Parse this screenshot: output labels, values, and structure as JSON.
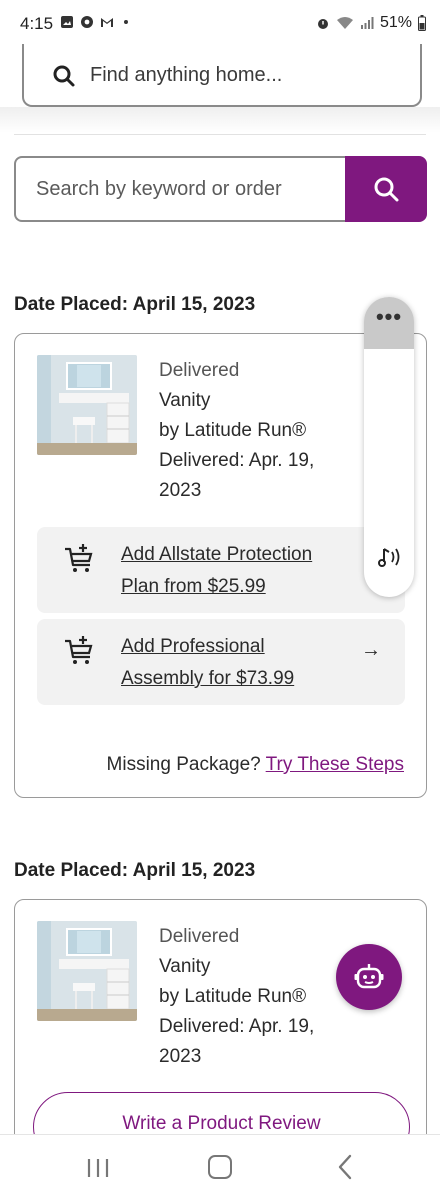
{
  "status_bar": {
    "time": "4:15",
    "battery": "51%",
    "icons": [
      "image-icon",
      "chrome-icon",
      "gmail-icon",
      "alarm-icon",
      "wifi-icon",
      "signal-icon",
      "battery-icon"
    ]
  },
  "top_search": {
    "placeholder": "Find anything home..."
  },
  "order_search": {
    "placeholder": "Search by keyword or order"
  },
  "orders": [
    {
      "date_label": "Date Placed: April 15, 2023",
      "status": "Delivered",
      "product": "Vanity",
      "brand": "by Latitude Run®",
      "delivered_line1": "Delivered: Apr. 19,",
      "delivered_line2": "2023",
      "addons": [
        {
          "line1": "Add Allstate Protection",
          "line2": "Plan from $25.99",
          "arrow": "→"
        },
        {
          "line1": "Add Professional",
          "line2": "Assembly for $73.99",
          "arrow": "→"
        }
      ],
      "missing_text": "Missing Package?",
      "missing_link": "Try These Steps"
    },
    {
      "date_label": "Date Placed: April 15, 2023",
      "status": "Delivered",
      "product": "Vanity",
      "brand": "by Latitude Run®",
      "delivered_line1": "Delivered: Apr. 19,",
      "delivered_line2": "2023",
      "review_button": "Write a Product Review"
    }
  ],
  "float_tools": {
    "more": "•••"
  },
  "colors": {
    "accent": "#7f187f",
    "addon_bg": "#f2f2f2",
    "border": "#9a9a9a"
  }
}
